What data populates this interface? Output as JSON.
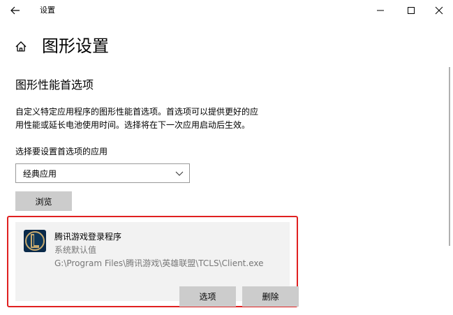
{
  "window": {
    "app_title": "设置",
    "back_icon": "back-arrow-icon",
    "controls": [
      "minimize-icon",
      "maximize-icon",
      "close-icon"
    ]
  },
  "header": {
    "home_icon": "home-icon",
    "title": "图形设置"
  },
  "section": {
    "title": "图形性能首选项",
    "description_line1": "自定义特定应用程序的图形性能首选项。首选项可以提供更好的应",
    "description_line2": "用性能或延长电池使用时间。选择将在下一次应用启动后生效。",
    "select_label": "选择要设置首选项的应用",
    "dropdown_value": "经典应用",
    "browse_label": "浏览"
  },
  "app_entry": {
    "name": "腾讯游戏登录程序",
    "preference": "系统默认值",
    "path": "G:\\Program Files\\腾讯游戏\\英雄联盟\\TCLS\\Client.exe",
    "options_label": "选项",
    "remove_label": "删除"
  },
  "colors": {
    "highlight_border": "#e02020",
    "button_bg": "#cccccc",
    "card_bg": "#f2f2f2"
  }
}
